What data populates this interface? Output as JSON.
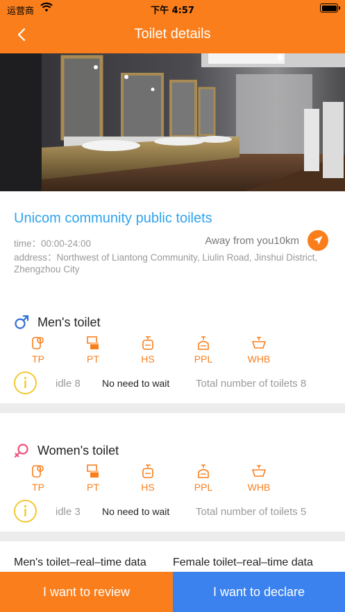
{
  "status_bar": {
    "carrier": "运营商",
    "time": "下午 4:57",
    "icons": [
      "wifi-icon",
      "battery-icon"
    ]
  },
  "nav": {
    "title": "Toilet details",
    "back_icon": "chevron-left-icon"
  },
  "colors": {
    "primary_orange": "#fa7f1c",
    "accent_blue": "#2fa3ee",
    "declare_blue": "#3b82ee",
    "info_yellow": "#f5c72e",
    "female_pink": "#ef4d7a"
  },
  "toilet": {
    "name": "Unicom community public toilets",
    "time": "time：00:00-24:00",
    "away": "Away from you10km",
    "address": "address：Northwest of Liantong Community, Liulin Road, Jinshui District, Zhengzhou City"
  },
  "men": {
    "title": "Men's toilet",
    "amenities": [
      "TP",
      "PT",
      "HS",
      "PPL",
      "WHB"
    ],
    "idle": "idle 8",
    "wait": "No need to wait",
    "total": "Total number of toilets 8"
  },
  "women": {
    "title": "Women's toilet",
    "amenities": [
      "TP",
      "PT",
      "HS",
      "PPL",
      "WHB"
    ],
    "idle": "idle 3",
    "wait": "No need to wait",
    "total": "Total number of toilets 5"
  },
  "realtime": {
    "men_label": "Men's toilet–real–time data",
    "female_label": "Female toilet–real–time data"
  },
  "actions": {
    "review": "I want to review",
    "declare": "I want to declare"
  }
}
